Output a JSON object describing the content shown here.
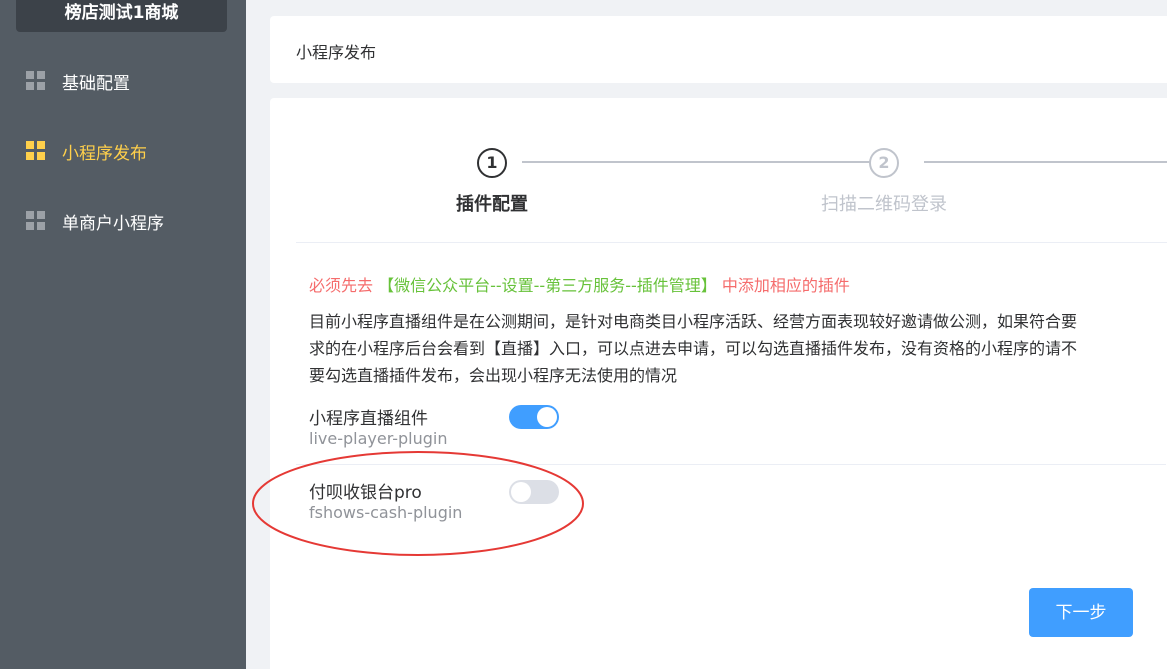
{
  "sidebar": {
    "shop_name": "榜店测试1商城",
    "items": [
      {
        "label": "基础配置",
        "active": false
      },
      {
        "label": "小程序发布",
        "active": true
      },
      {
        "label": "单商户小程序",
        "active": false
      }
    ]
  },
  "header": {
    "title": "小程序发布"
  },
  "steps": [
    {
      "number": "1",
      "title": "插件配置",
      "status": "active"
    },
    {
      "number": "2",
      "title": "扫描二维码登录",
      "status": "wait"
    }
  ],
  "notice": {
    "prefix": "必须先去",
    "path": "【微信公众平台--设置--第三方服务--插件管理】",
    "suffix": "中添加相应的插件"
  },
  "description": "目前小程序直播组件是在公测期间，是针对电商类目小程序活跃、经营方面表现较好邀请做公测，如果符合要求的在小程序后台会看到【直播】入口，可以点进去申请，可以勾选直播插件发布，没有资格的小程序的请不要勾选直播插件发布，会出现小程序无法使用的情况",
  "plugins": [
    {
      "name": "小程序直播组件",
      "code": "live-player-plugin",
      "enabled": true
    },
    {
      "name": "付呗收银台pro",
      "code": "fshows-cash-plugin",
      "enabled": false
    }
  ],
  "buttons": {
    "next": "下一步"
  },
  "colors": {
    "accent": "#409eff",
    "active_menu": "#ffd04b",
    "sidebar_bg": "#545c64",
    "warning": "#f56c6c",
    "success": "#67c23a",
    "annotation": "#e53935"
  },
  "icons": {
    "menu_item": "grid-icon"
  }
}
